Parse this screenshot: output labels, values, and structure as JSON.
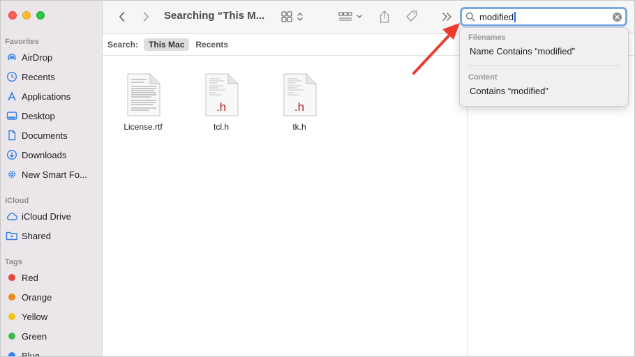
{
  "window": {
    "title": "Searching “This M..."
  },
  "sidebar": {
    "favorites_title": "Favorites",
    "favorites": [
      {
        "label": "AirDrop",
        "icon": "airdrop-icon"
      },
      {
        "label": "Recents",
        "icon": "clock-icon"
      },
      {
        "label": "Applications",
        "icon": "applications-icon"
      },
      {
        "label": "Desktop",
        "icon": "desktop-icon"
      },
      {
        "label": "Documents",
        "icon": "document-icon"
      },
      {
        "label": "Downloads",
        "icon": "download-icon"
      },
      {
        "label": "New Smart Fo...",
        "icon": "gear-icon"
      }
    ],
    "icloud_title": "iCloud",
    "icloud": [
      {
        "label": "iCloud Drive",
        "icon": "cloud-icon"
      },
      {
        "label": "Shared",
        "icon": "shared-folder-icon"
      }
    ],
    "tags_title": "Tags",
    "tags": [
      {
        "label": "Red",
        "color": "#e5453d"
      },
      {
        "label": "Orange",
        "color": "#ee8a18"
      },
      {
        "label": "Yellow",
        "color": "#f2c318"
      },
      {
        "label": "Green",
        "color": "#43b94c"
      },
      {
        "label": "Blue",
        "color": "#3b82f0"
      }
    ]
  },
  "search": {
    "query": "modified"
  },
  "scope": {
    "label": "Search:",
    "options": [
      "This Mac",
      "Recents"
    ],
    "active": "This Mac"
  },
  "files": [
    {
      "name": "License.rtf",
      "kind": "rtf-document-icon"
    },
    {
      "name": "tcl.h",
      "kind": "header-file-icon",
      "badge": ".h"
    },
    {
      "name": "tk.h",
      "kind": "header-file-icon",
      "badge": ".h"
    }
  ],
  "suggestions": {
    "filenames_title": "Filenames",
    "filenames_item": "Name Contains “modified”",
    "content_title": "Content",
    "content_item": "Contains “modified”"
  },
  "colors": {
    "accent": "#1e6fe8",
    "annotation_arrow": "#ee3b30",
    "header_badge": "#b0202a"
  }
}
